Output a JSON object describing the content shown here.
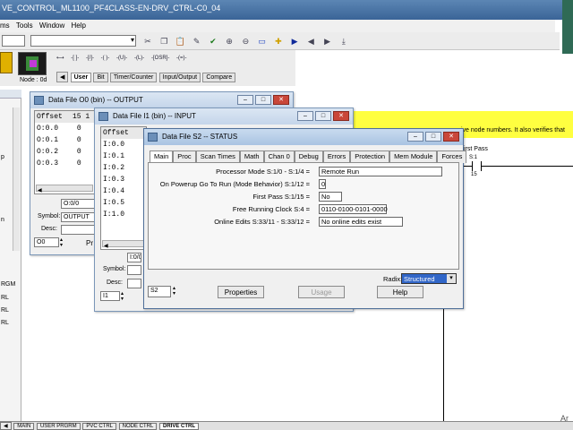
{
  "app": {
    "title": "VE_CONTROL_ML1100_PF4CLASS-EN-DRV_CTRL-C0_04"
  },
  "menu": {
    "items": [
      "ms",
      "Tools",
      "Window",
      "Help"
    ]
  },
  "instr": {
    "node_label": "Node : 0d",
    "tabs": [
      "User",
      "Bit",
      "Timer/Counter",
      "Input/Output",
      "Compare"
    ],
    "glyphs": [
      "⟷",
      "-[ ]-",
      "-[/]-",
      "-( )-",
      "-(U)-",
      "-(L)-",
      "-[OSR]-",
      "-(=)-"
    ]
  },
  "ladder": {
    "note": "ive node numbers.  It also verifies that",
    "first_pass": "irst Pass",
    "bit": "S:1",
    "bit_num": "15"
  },
  "left_pane": {
    "labels": [
      "p",
      "n",
      "RGM",
      "RL",
      "RL",
      "RL"
    ]
  },
  "win_output": {
    "title": "Data File O0 (bin)  --  OUTPUT",
    "header_offset": "Offset",
    "header_bits": "15 1",
    "rows": [
      {
        "offset": "O:0.0",
        "val": "0"
      },
      {
        "offset": "O:0.1",
        "val": "0"
      },
      {
        "offset": "O:0.2",
        "val": "0"
      },
      {
        "offset": "O:0.3",
        "val": "0"
      }
    ],
    "address": "O:0/0",
    "symbol_label": "Symbol:",
    "symbol_value": "OUTPUT",
    "desc_label": "Desc:",
    "file_field": "O0",
    "props_short": "Pr"
  },
  "win_input": {
    "title": "Data File I1 (bin)  --  INPUT",
    "header_offset": "Offset",
    "rows": [
      "I:0.0",
      "I:0.1",
      "I:0.2",
      "I:0.3",
      "I:0.4",
      "I:0.5",
      "I:1.0"
    ],
    "address": "I:0/0",
    "symbol_label": "Symbol:",
    "desc_label": "Desc:",
    "file_field": "I1"
  },
  "win_status": {
    "title": "Data File S2  --  STATUS",
    "tabs": [
      "Main",
      "Proc",
      "Scan Times",
      "Math",
      "Chan 0",
      "Debug",
      "Errors",
      "Protection",
      "Mem Module",
      "Forces"
    ],
    "rows": [
      {
        "label": "Processor Mode S:1/0 - S:1/4 =",
        "value": "Remote Run"
      },
      {
        "label": "On Powerup Go To Run (Mode Behavior) S:1/12 =",
        "value": "0"
      },
      {
        "label": "First Pass S:1/15 =",
        "value": "No"
      },
      {
        "label": "Free Running Clock S:4 =",
        "value": "0110-0100-0101-0000"
      },
      {
        "label": "Online Edits S:33/11 - S:33/12 =",
        "value": "No online edits exist"
      }
    ],
    "radix_label": "Radix:",
    "radix_value": "Structured",
    "file_field": "S2",
    "btn_properties": "Properties",
    "btn_usage": "Usage",
    "btn_help": "Help"
  },
  "bottom_tabs": [
    "MAIN",
    "USER PRGRM",
    "PVC CTRL",
    "NODE CTRL",
    "DRIVE CTRL"
  ],
  "colors": {
    "yellow_note": "#ffff40",
    "radix_bg": "#3166c8",
    "title_blue": "#3a6497"
  }
}
